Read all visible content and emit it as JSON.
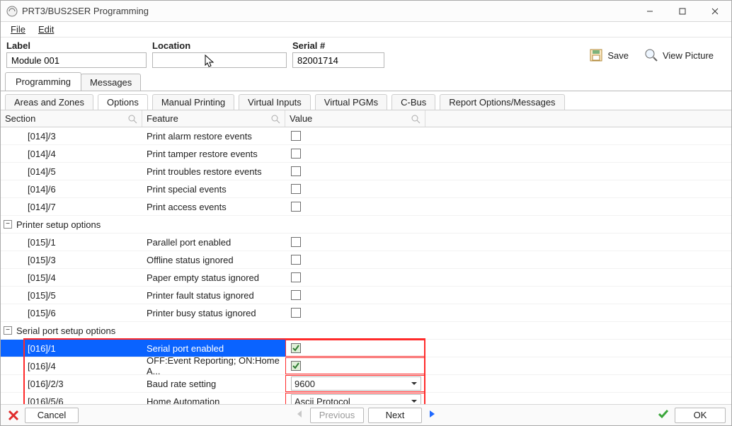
{
  "window": {
    "title": "PRT3/BUS2SER Programming"
  },
  "menu": {
    "file": "File",
    "edit": "Edit"
  },
  "form": {
    "label_label": "Label",
    "label_value": "Module 001",
    "location_label": "Location",
    "location_value": "",
    "serial_label": "Serial #",
    "serial_value": "82001714"
  },
  "actions": {
    "save": "Save",
    "view_picture": "View Picture"
  },
  "tabs": {
    "programming": "Programming",
    "messages": "Messages"
  },
  "subtabs": {
    "areas_zones": "Areas and Zones",
    "options": "Options",
    "manual_printing": "Manual Printing",
    "virtual_inputs": "Virtual Inputs",
    "virtual_pgms": "Virtual PGMs",
    "cbus": "C-Bus",
    "report_options": "Report Options/Messages"
  },
  "grid": {
    "headers": {
      "section": "Section",
      "feature": "Feature",
      "value": "Value"
    }
  },
  "groups": {
    "printer_setup": "Printer setup options",
    "serial_port_setup": "Serial port setup options"
  },
  "rows": [
    {
      "section": "[014]/3",
      "feature": "Print alarm restore events",
      "value_type": "checkbox",
      "checked": false
    },
    {
      "section": "[014]/4",
      "feature": "Print tamper restore events",
      "value_type": "checkbox",
      "checked": false
    },
    {
      "section": "[014]/5",
      "feature": "Print troubles restore events",
      "value_type": "checkbox",
      "checked": false
    },
    {
      "section": "[014]/6",
      "feature": "Print special events",
      "value_type": "checkbox",
      "checked": false
    },
    {
      "section": "[014]/7",
      "feature": "Print access events",
      "value_type": "checkbox",
      "checked": false
    }
  ],
  "rows_printer": [
    {
      "section": "[015]/1",
      "feature": "Parallel port enabled",
      "value_type": "checkbox",
      "checked": false
    },
    {
      "section": "[015]/3",
      "feature": "Offline status ignored",
      "value_type": "checkbox",
      "checked": false
    },
    {
      "section": "[015]/4",
      "feature": "Paper empty status ignored",
      "value_type": "checkbox",
      "checked": false
    },
    {
      "section": "[015]/5",
      "feature": "Printer fault status ignored",
      "value_type": "checkbox",
      "checked": false
    },
    {
      "section": "[015]/6",
      "feature": "Printer busy status ignored",
      "value_type": "checkbox",
      "checked": false
    }
  ],
  "rows_serial": [
    {
      "section": "[016]/1",
      "feature": "Serial port enabled",
      "value_type": "checkbox",
      "checked": true,
      "selected": true
    },
    {
      "section": "[016]/4",
      "feature": "OFF:Event Reporting; ON:Home A...",
      "value_type": "checkbox",
      "checked": true
    },
    {
      "section": "[016]/2/3",
      "feature": "Baud rate setting",
      "value_type": "combo",
      "value": "9600"
    },
    {
      "section": "[016]/5/6",
      "feature": "Home Automation",
      "value_type": "combo",
      "value": "Ascii Protocol"
    }
  ],
  "footer": {
    "cancel": "Cancel",
    "previous": "Previous",
    "next": "Next",
    "ok": "OK"
  }
}
